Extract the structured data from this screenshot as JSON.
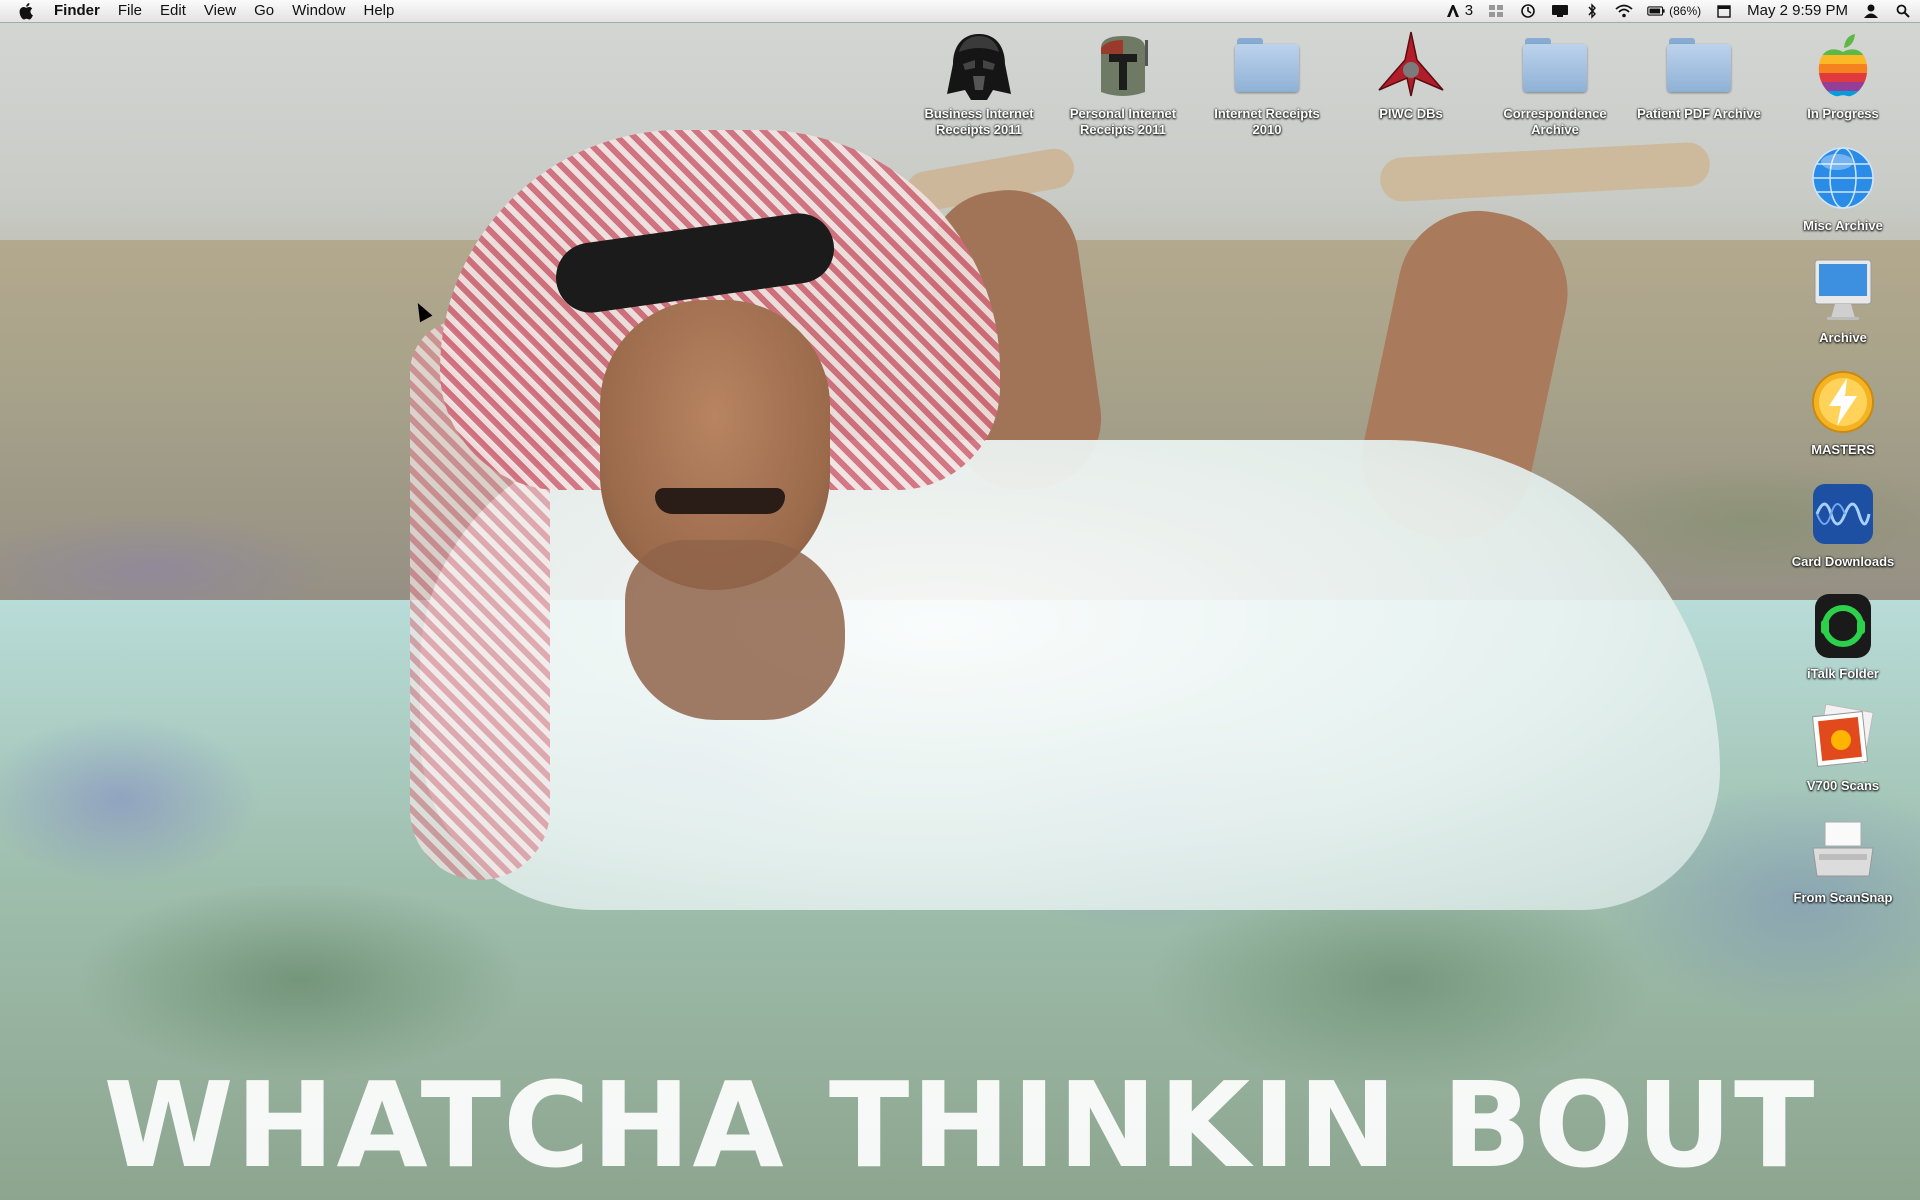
{
  "menubar": {
    "app_name": "Finder",
    "menus": [
      "File",
      "Edit",
      "View",
      "Go",
      "Window",
      "Help"
    ],
    "status": {
      "adobe_count": "3",
      "battery": "(86%)",
      "datetime": "May 2  9:59 PM"
    }
  },
  "desktop": {
    "icons_top_row": [
      {
        "label": "Business Internet Receipts 2011",
        "icon": "darth-vader-icon"
      },
      {
        "label": "Personal Internet Receipts 2011",
        "icon": "boba-fett-icon"
      },
      {
        "label": "Internet Receipts 2010",
        "icon": "folder-icon"
      },
      {
        "label": "PIWC DBs",
        "icon": "klingon-emblem-icon"
      },
      {
        "label": "Correspondence Archive",
        "icon": "folder-icon"
      },
      {
        "label": "Patient PDF Archive",
        "icon": "folder-icon"
      }
    ],
    "icons_right_column": [
      {
        "label": "In Progress",
        "icon": "apple-logo-icon"
      },
      {
        "label": "Misc Archive",
        "icon": "globe-icon"
      },
      {
        "label": "Archive",
        "icon": "imac-icon"
      },
      {
        "label": "MASTERS",
        "icon": "lightning-icon"
      },
      {
        "label": "Card Downloads",
        "icon": "waveform-icon"
      },
      {
        "label": "iTalk Folder",
        "icon": "headset-icon"
      },
      {
        "label": "V700 Scans",
        "icon": "photo-icon"
      },
      {
        "label": "From ScanSnap",
        "icon": "scanner-icon"
      }
    ]
  },
  "wallpaper": {
    "caption": "WHATCHA THINKIN BOUT"
  }
}
